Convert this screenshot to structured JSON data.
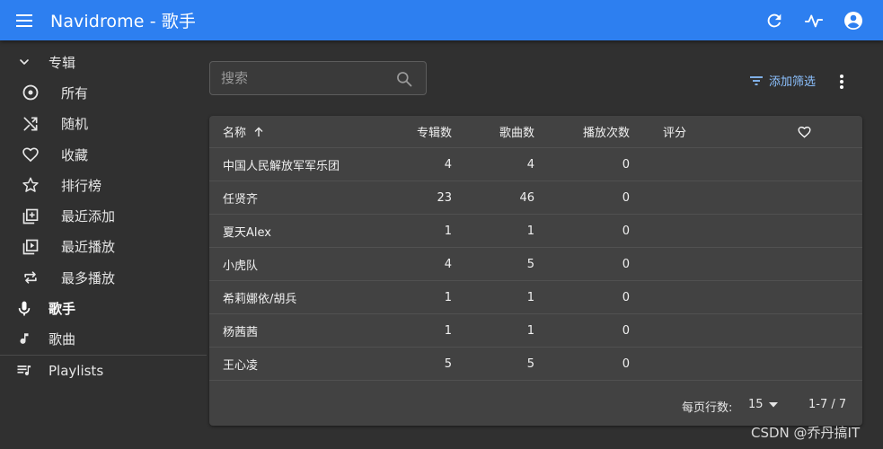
{
  "app": {
    "title": "Navidrome - 歌手"
  },
  "sidebar": {
    "section_albums": "专辑",
    "album_items": [
      {
        "label": "所有",
        "icon": "disc-icon"
      },
      {
        "label": "随机",
        "icon": "shuffle-icon"
      },
      {
        "label": "收藏",
        "icon": "heart-icon"
      },
      {
        "label": "排行榜",
        "icon": "star-icon"
      },
      {
        "label": "最近添加",
        "icon": "library-add-icon"
      },
      {
        "label": "最近播放",
        "icon": "video-library-icon"
      },
      {
        "label": "最多播放",
        "icon": "repeat-icon"
      }
    ],
    "artists": "歌手",
    "songs": "歌曲",
    "playlists": "Playlists"
  },
  "search": {
    "placeholder": "搜索",
    "value": ""
  },
  "toolbar": {
    "filter_label": "添加筛选"
  },
  "table": {
    "columns": {
      "name": "名称",
      "albums": "专辑数",
      "songs": "歌曲数",
      "plays": "播放次数",
      "rating": "评分"
    },
    "rows": [
      {
        "name": "中国人民解放军军乐团",
        "albums": "4",
        "songs": "4",
        "plays": "0"
      },
      {
        "name": "任贤齐",
        "albums": "23",
        "songs": "46",
        "plays": "0"
      },
      {
        "name": "夏天Alex",
        "albums": "1",
        "songs": "1",
        "plays": "0"
      },
      {
        "name": "小虎队",
        "albums": "4",
        "songs": "5",
        "plays": "0"
      },
      {
        "name": "希莉娜依/胡兵",
        "albums": "1",
        "songs": "1",
        "plays": "0"
      },
      {
        "name": "杨茜茜",
        "albums": "1",
        "songs": "1",
        "plays": "0"
      },
      {
        "name": "王心凌",
        "albums": "5",
        "songs": "5",
        "plays": "0"
      }
    ]
  },
  "pager": {
    "rows_per_page_label": "每页行数:",
    "rows_per_page_value": "15",
    "range": "1-7 / 7"
  },
  "watermark": "CSDN @乔丹搞IT",
  "colors": {
    "appbar": "#2d7ff0",
    "background": "#303030",
    "card": "#424242",
    "accent_link": "#8cc1ff"
  }
}
